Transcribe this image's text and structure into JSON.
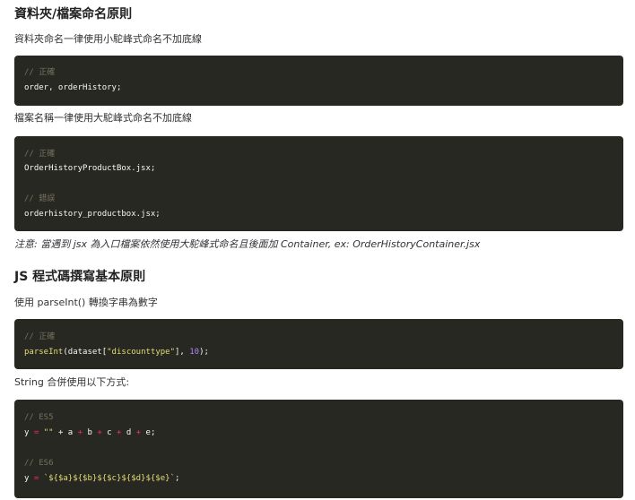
{
  "section1": {
    "heading": "資料夾/檔案命名原則",
    "folder_rule": "資料夾命名一律使用小駝峰式命名不加底線",
    "code1": {
      "comment": "// 正確",
      "line": "order, orderHistory;"
    },
    "file_rule": "檔案名稱一律使用大駝峰式命名不加底線",
    "code2": {
      "comment_ok": "// 正確",
      "line_ok": "OrderHistoryProductBox.jsx;",
      "comment_bad": "// 錯誤",
      "line_bad": "orderhistory_productbox.jsx;"
    },
    "note": "注意: 當遇到 jsx 為入口檔案依然使用大駝峰式命名且後面加 Container, ex: OrderHistoryContainer.jsx"
  },
  "section2": {
    "heading": "JS 程式碼撰寫基本原則",
    "parse_rule": "使用 parseInt() 轉換字串為數字",
    "code3": {
      "comment": "// 正確",
      "fn": "parseInt",
      "arg_open": "(dataset[",
      "str": "\"discounttype\"",
      "mid": "], ",
      "num": "10",
      "end": ");"
    },
    "string_rule": "String 合併使用以下方式:",
    "code4": {
      "comment_es5": "// ES5",
      "es5_y": "y",
      "es5_eq": " = ",
      "es5_str": "\"\"",
      "es5_rest": [
        " + a ",
        "+",
        " b ",
        "+",
        " c ",
        "+",
        " d ",
        "+",
        " e;"
      ],
      "comment_es6": "// ES6",
      "es6_y": "y",
      "es6_eq": " = ",
      "es6_tpl": "`${$a}${$b}${$c}${$d}${$e}`",
      "es6_end": ";"
    }
  }
}
